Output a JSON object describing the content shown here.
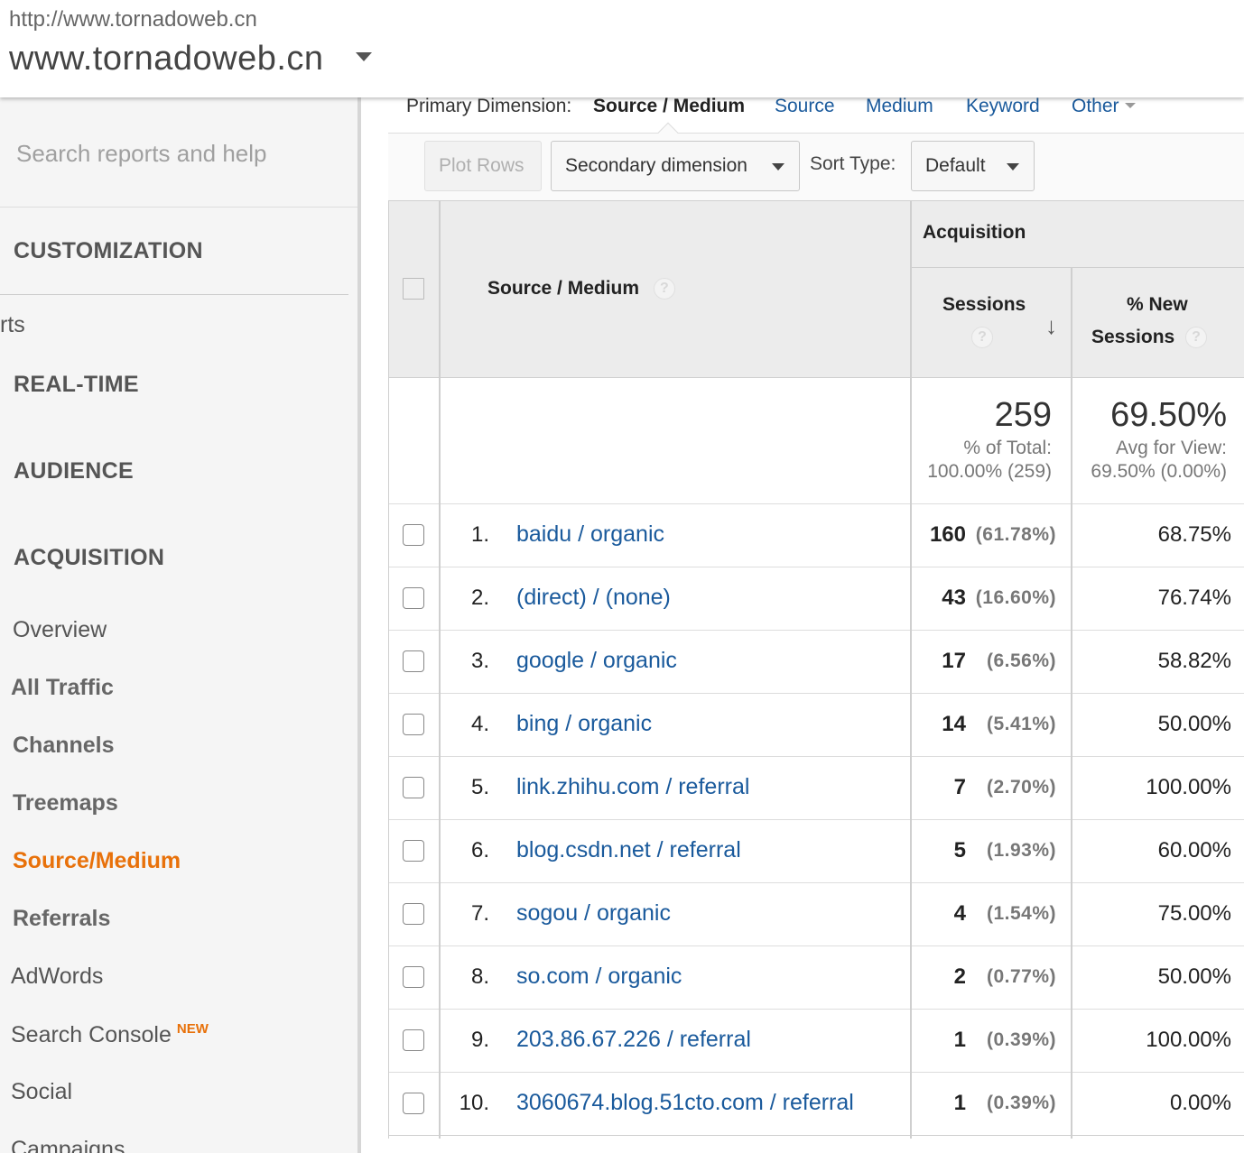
{
  "header": {
    "url": "http://www.tornadoweb.cn",
    "account": "www.tornadoweb.cn"
  },
  "sidebar": {
    "search_placeholder": "Search reports and help",
    "customization": "CUSTOMIZATION",
    "partial_item": "rts",
    "realtime": "REAL-TIME",
    "audience": "AUDIENCE",
    "acquisition": "ACQUISITION",
    "items": [
      {
        "label": "Overview"
      },
      {
        "label": "All Traffic"
      },
      {
        "label": "Channels"
      },
      {
        "label": "Treemaps"
      },
      {
        "label": "Source/Medium"
      },
      {
        "label": "Referrals"
      },
      {
        "label": "AdWords"
      },
      {
        "label": "Search Console",
        "badge": "NEW"
      },
      {
        "label": "Social"
      },
      {
        "label": "Campaigns"
      }
    ]
  },
  "primary_dimension": {
    "label": "Primary Dimension:",
    "current": "Source / Medium",
    "links": [
      "Source",
      "Medium",
      "Keyword",
      "Other"
    ]
  },
  "toolbar": {
    "plot_rows": "Plot Rows",
    "secondary_dimension": "Secondary dimension",
    "sort_type_label": "Sort Type:",
    "sort_type_value": "Default"
  },
  "table": {
    "col_source": "Source / Medium",
    "group_acquisition": "Acquisition",
    "col_sessions": "Sessions",
    "col_new_sessions_line1": "% New",
    "col_new_sessions_line2": "Sessions",
    "help": "?",
    "totals": {
      "sessions": "259",
      "sessions_sub1": "% of Total:",
      "sessions_sub2": "100.00% (259)",
      "new_sessions": "69.50%",
      "new_sessions_sub1": "Avg for View:",
      "new_sessions_sub2": "69.50% (0.00%)"
    },
    "rows": [
      {
        "num": "1.",
        "source": "baidu / organic",
        "sessions": "160",
        "pct": "(61.78%)",
        "new": "68.75%"
      },
      {
        "num": "2.",
        "source": "(direct) / (none)",
        "sessions": "43",
        "pct": "(16.60%)",
        "new": "76.74%"
      },
      {
        "num": "3.",
        "source": "google / organic",
        "sessions": "17",
        "pct": "(6.56%)",
        "new": "58.82%"
      },
      {
        "num": "4.",
        "source": "bing / organic",
        "sessions": "14",
        "pct": "(5.41%)",
        "new": "50.00%"
      },
      {
        "num": "5.",
        "source": "link.zhihu.com / referral",
        "sessions": "7",
        "pct": "(2.70%)",
        "new": "100.00%"
      },
      {
        "num": "6.",
        "source": "blog.csdn.net / referral",
        "sessions": "5",
        "pct": "(1.93%)",
        "new": "60.00%"
      },
      {
        "num": "7.",
        "source": "sogou / organic",
        "sessions": "4",
        "pct": "(1.54%)",
        "new": "75.00%"
      },
      {
        "num": "8.",
        "source": "so.com / organic",
        "sessions": "2",
        "pct": "(0.77%)",
        "new": "50.00%"
      },
      {
        "num": "9.",
        "source": "203.86.67.226 / referral",
        "sessions": "1",
        "pct": "(0.39%)",
        "new": "100.00%"
      },
      {
        "num": "10.",
        "source": "3060674.blog.51cto.com / referral",
        "sessions": "1",
        "pct": "(0.39%)",
        "new": "0.00%"
      }
    ]
  }
}
